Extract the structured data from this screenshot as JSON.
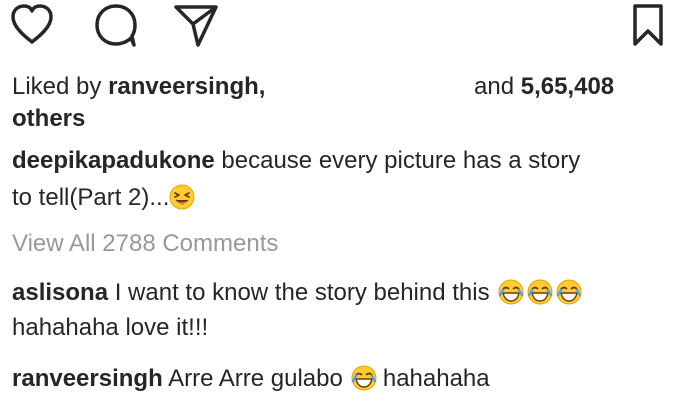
{
  "actions": {
    "like_icon": "heart-icon",
    "comment_icon": "comment-bubble-icon",
    "share_icon": "send-paper-plane-icon",
    "save_icon": "bookmark-icon"
  },
  "likes": {
    "prefix": "Liked by",
    "user": "ranveersingh,",
    "middle": "and",
    "count": "5,65,408",
    "suffix": "others"
  },
  "caption": {
    "user": "deepikapadukone",
    "text_line1": "because every picture has a story",
    "text_line2": "to tell(Part 2)...",
    "emoji": "squinting-tongue-face-emoji"
  },
  "view_all_label": "View All 2788 Comments",
  "comments": [
    {
      "user": "aslisona",
      "text_line1": "I want to know the story behind this",
      "text_line2": "hahahaha love it!!!",
      "emoji": "face-with-tears-of-joy-emoji",
      "emoji_count": 3
    },
    {
      "user": "ranveersingh",
      "text_before": "Arre Arre gulabo",
      "text_after": "hahahaha",
      "emoji": "face-with-tears-of-joy-emoji",
      "emoji_count": 1
    }
  ],
  "colors": {
    "text": "#262626",
    "muted": "#999999",
    "emoji_fill": "#ffcc33"
  }
}
